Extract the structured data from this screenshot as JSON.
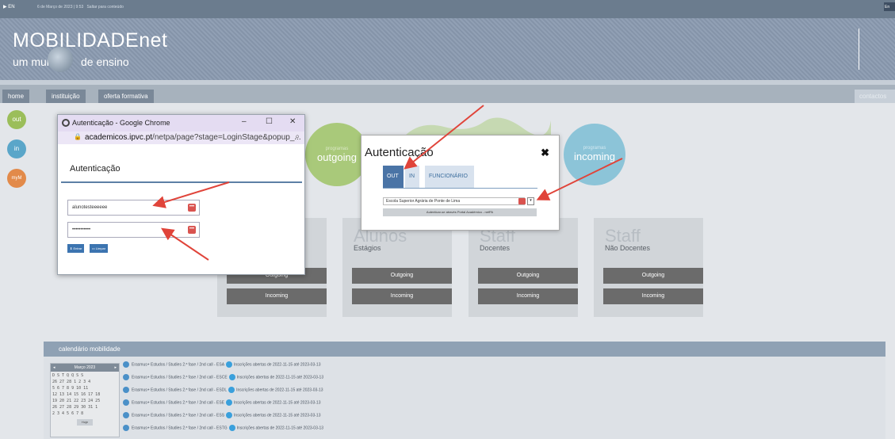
{
  "topbar": {
    "lang": "EN",
    "datetime": "6 de Março de 2023 | 9:53",
    "skip_link": "Saltar para conteúdo",
    "right_lang": "En"
  },
  "header": {
    "logo_main": "MOBILIDADEnet",
    "tagline_left": "um mundo",
    "tagline_right": "de ensino"
  },
  "nav": {
    "items": [
      "home",
      "instituição",
      "oferta formativa"
    ],
    "contacts": "contactos"
  },
  "side_circles": [
    "out",
    "in",
    "myM"
  ],
  "big_circles": {
    "outgoing_small": "programas",
    "outgoing": "outgoing",
    "incoming_small": "programas",
    "incoming": "incoming"
  },
  "cards": [
    {
      "title": "",
      "subtitle": "",
      "buttons": [
        "Outgoing",
        "Incoming"
      ]
    },
    {
      "title": "Alunos",
      "subtitle": "Estágios",
      "buttons": [
        "Outgoing",
        "Incoming"
      ]
    },
    {
      "title": "Staff",
      "subtitle": "Docentes",
      "buttons": [
        "Outgoing",
        "Incoming"
      ]
    },
    {
      "title": "Staff",
      "subtitle": "Não Docentes",
      "buttons": [
        "Outgoing",
        "Incoming"
      ]
    }
  ],
  "popup": {
    "window_title": "Autenticação - Google Chrome",
    "url_host": "academicos.ipvc.pt",
    "url_path": "/netpa/page?stage=LoginStage&popup_...",
    "heading": "Autenticação",
    "username_value": "alunotesteeeeee",
    "password_value": "•••••••••••",
    "enter_label": "Entrar",
    "clear_label": "Limpar"
  },
  "modal": {
    "title": "Autenticação",
    "tabs": [
      "OUT",
      "IN",
      "FUNCIONÁRIO"
    ],
    "select_value": "Escola Superior Agrária de Ponte de Lima",
    "submit_label": "Autenticar-se através Portal Académico - netPA"
  },
  "calendar": {
    "heading": "calendário mobilidade",
    "month_label": "Março 2023",
    "weekdays": "D  S  T  Q  Q  S  S",
    "weeks": [
      "26 27 28  1  2  3  4",
      " 5  6  7  8  9 10 11",
      "12 13 14 15 16 17 18",
      "19 20 21 22 23 24 25",
      "26 27 28 29 30 31  1",
      " 2  3  4  5  6  7  8"
    ],
    "today_label": "Hoje",
    "events": [
      {
        "name": "Erasmus+ Estudos / Studies 2.ª fase / 2nd call - ESA",
        "info": "Inscrições abertas de 2022-11-15 até 2023-03-13"
      },
      {
        "name": "Erasmus+ Estudos / Studies 2.ª fase / 2nd call - ESCE",
        "info": "Inscrições abertas de 2022-11-15 até 2023-03-13"
      },
      {
        "name": "Erasmus+ Estudos / Studies 2.ª fase / 2nd call - ESDL",
        "info": "Inscrições abertas de 2022-11-15 até 2023-03-13"
      },
      {
        "name": "Erasmus+ Estudos / Studies 2.ª fase / 2nd call - ESE",
        "info": "Inscrições abertas de 2022-11-15 até 2023-03-13"
      },
      {
        "name": "Erasmus+ Estudos / Studies 2.ª fase / 2nd call - ESS",
        "info": "Inscrições abertas de 2022-11-15 até 2023-03-13"
      },
      {
        "name": "Erasmus+ Estudos / Studies 2.ª fase / 2nd call - ESTG",
        "info": "Inscrições abertas de 2022-11-15 até 2023-03-13"
      }
    ]
  },
  "colors": {
    "header_bg": "#8a9ab0",
    "nav_item": "#7a8898",
    "tab_active": "#4a74a6",
    "annotation_arrow": "#e0443a",
    "outgoing_circle": "#a9c97a",
    "incoming_circle": "#8cc4d8"
  }
}
